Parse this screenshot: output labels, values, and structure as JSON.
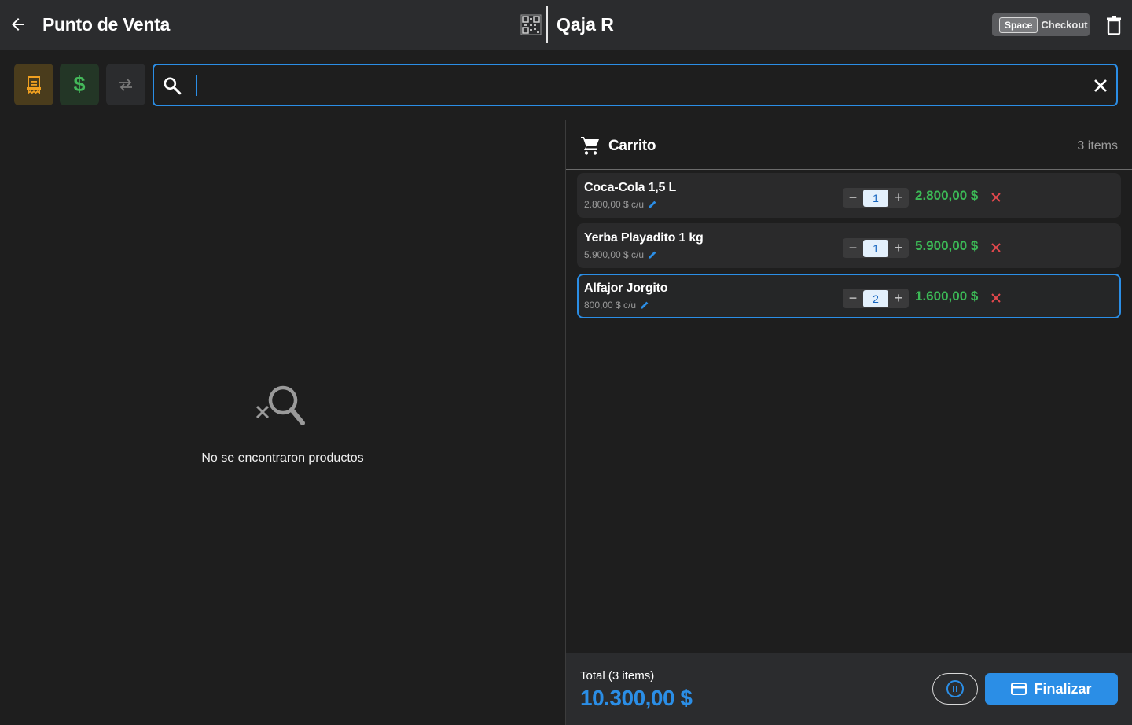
{
  "header": {
    "title": "Punto de Venta",
    "register": "Qaja R",
    "shortcut_key": "Space",
    "shortcut_label": "Checkout"
  },
  "toolbar": {
    "modes": [
      {
        "icon": "receipt-icon",
        "color": "#f0a020"
      },
      {
        "icon": "dollar-icon",
        "label": "$",
        "color": "#44b85a"
      },
      {
        "icon": "swap-icon",
        "color": "#8a8a8a"
      }
    ],
    "search": {
      "value": "",
      "placeholder": ""
    }
  },
  "products": {
    "empty_message": "No se encontraron productos"
  },
  "cart": {
    "title": "Carrito",
    "count_label": "3 items",
    "items": [
      {
        "name": "Coca-Cola 1,5 L",
        "unit_price": "2.800,00 $ c/u",
        "qty": "1",
        "total": "2.800,00 $",
        "selected": false
      },
      {
        "name": "Yerba Playadito 1 kg",
        "unit_price": "5.900,00 $ c/u",
        "qty": "1",
        "total": "5.900,00 $",
        "selected": false
      },
      {
        "name": "Alfajor Jorgito",
        "unit_price": "800,00 $ c/u",
        "qty": "2",
        "total": "1.600,00 $",
        "selected": true
      }
    ]
  },
  "footer": {
    "total_label": "Total (3 items)",
    "total_value": "10.300,00 $",
    "finish_label": "Finalizar"
  },
  "colors": {
    "accent": "#2b8ee6",
    "price_green": "#3cb956",
    "remove_red": "#e5484d",
    "background": "#1e1e1e",
    "bar": "#2b2c2e"
  }
}
